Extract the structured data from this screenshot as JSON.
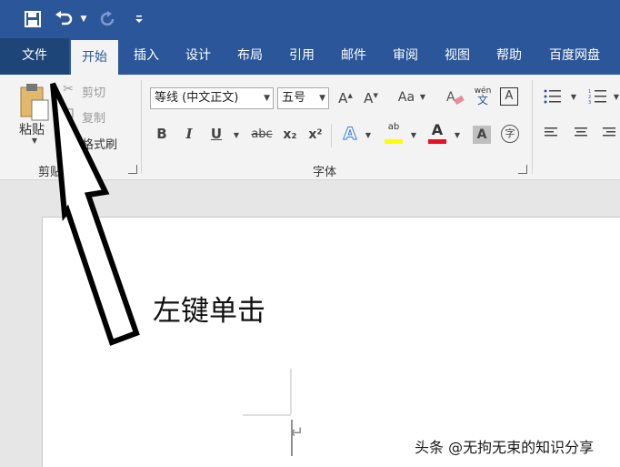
{
  "quick_access": {
    "save_icon": "save-icon",
    "undo_icon": "undo-icon",
    "redo_icon": "redo-icon",
    "customize_icon": "customize-qat-icon"
  },
  "tabs": [
    {
      "label": "文件"
    },
    {
      "label": "开始"
    },
    {
      "label": "插入"
    },
    {
      "label": "设计"
    },
    {
      "label": "布局"
    },
    {
      "label": "引用"
    },
    {
      "label": "邮件"
    },
    {
      "label": "审阅"
    },
    {
      "label": "视图"
    },
    {
      "label": "帮助"
    },
    {
      "label": "百度网盘"
    }
  ],
  "active_tab": "开始",
  "clipboard": {
    "paste_label": "粘贴",
    "cut_label": "剪切",
    "copy_label": "复制",
    "format_painter_label": "格式刷",
    "group_label": "剪贴板"
  },
  "font": {
    "font_name": "等线 (中文正文)",
    "font_size": "五号",
    "grow_font": "A",
    "shrink_font": "A",
    "change_case": "Aa",
    "bold": "B",
    "italic": "I",
    "underline": "U",
    "strikethrough": "abc",
    "subscript": "x₂",
    "superscript": "x²",
    "phonetic_top": "wén",
    "phonetic_bottom": "文",
    "border_char": "A",
    "shading_char": "A",
    "enclose_char": "字",
    "highlight_text": "ab",
    "font_color_char": "A",
    "text_effect_char": "A",
    "group_label": "字体"
  },
  "document": {
    "annotation": "左键单击",
    "paragraph_mark": "↵"
  },
  "watermark": "头条 @无拘无束的知识分享",
  "colors": {
    "title_bar": "#2b579a",
    "file_tab": "#1e4577",
    "ribbon": "#f3f3f3",
    "highlight": "#ffff00",
    "font_color": "#e81123"
  }
}
